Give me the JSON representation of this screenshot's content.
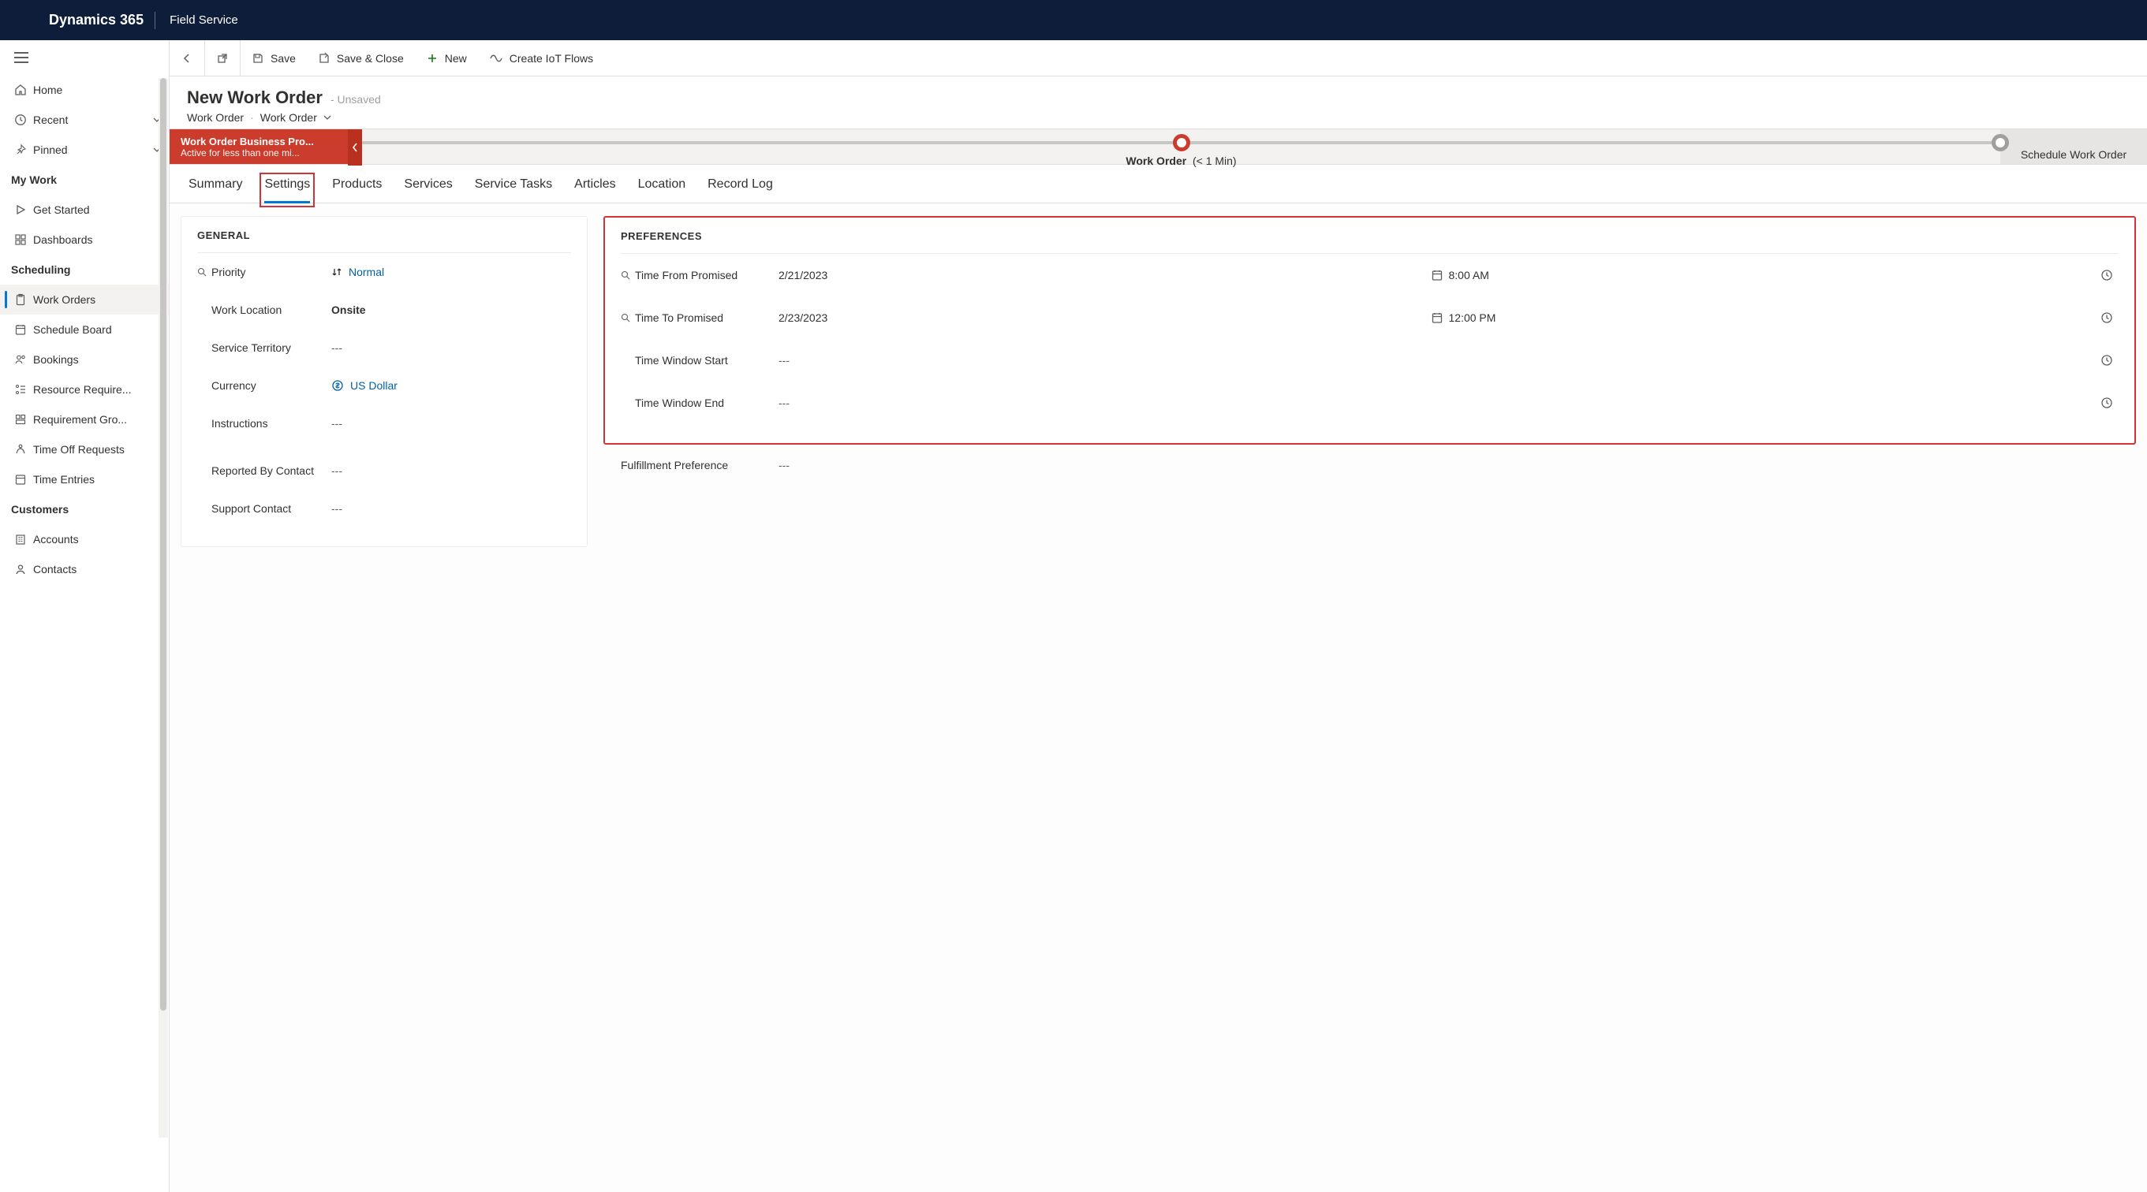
{
  "brand": {
    "primary": "Dynamics 365",
    "secondary": "Field Service"
  },
  "nav": {
    "home": "Home",
    "recent": "Recent",
    "pinned": "Pinned",
    "groups": {
      "mywork": "My Work",
      "scheduling": "Scheduling",
      "customers": "Customers"
    },
    "items": {
      "get_started": "Get Started",
      "dashboards": "Dashboards",
      "work_orders": "Work Orders",
      "schedule_board": "Schedule Board",
      "bookings": "Bookings",
      "resource_req": "Resource Require...",
      "requirement_groups": "Requirement Gro...",
      "time_off": "Time Off Requests",
      "time_entries": "Time Entries",
      "accounts": "Accounts",
      "contacts": "Contacts"
    }
  },
  "commands": {
    "save": "Save",
    "save_close": "Save & Close",
    "new": "New",
    "create_iot": "Create IoT Flows"
  },
  "header": {
    "title": "New Work Order",
    "suffix": "- Unsaved",
    "breadcrumb_entity": "Work Order",
    "breadcrumb_form": "Work Order"
  },
  "bpf": {
    "active_title": "Work Order Business Pro...",
    "active_sub": "Active for less than one mi...",
    "stage1_name": "Work Order",
    "stage1_time": "(< 1 Min)",
    "stage2_name": "Schedule Work Order"
  },
  "tabs": {
    "summary": "Summary",
    "settings": "Settings",
    "products": "Products",
    "services": "Services",
    "service_tasks": "Service Tasks",
    "articles": "Articles",
    "location": "Location",
    "record_log": "Record Log"
  },
  "general": {
    "section_title": "GENERAL",
    "priority_label": "Priority",
    "priority_value": "Normal",
    "work_location_label": "Work Location",
    "work_location_value": "Onsite",
    "service_territory_label": "Service Territory",
    "service_territory_value": "---",
    "currency_label": "Currency",
    "currency_value": "US Dollar",
    "instructions_label": "Instructions",
    "instructions_value": "---",
    "reported_by_label": "Reported By Contact",
    "reported_by_value": "---",
    "support_contact_label": "Support Contact",
    "support_contact_value": "---"
  },
  "preferences": {
    "section_title": "PREFERENCES",
    "time_from_label": "Time From Promised",
    "time_from_date": "2/21/2023",
    "time_from_time": "8:00 AM",
    "time_to_label": "Time To Promised",
    "time_to_date": "2/23/2023",
    "time_to_time": "12:00 PM",
    "window_start_label": "Time Window Start",
    "window_start_value": "---",
    "window_end_label": "Time Window End",
    "window_end_value": "---",
    "fulfillment_label": "Fulfillment Preference",
    "fulfillment_value": "---"
  }
}
